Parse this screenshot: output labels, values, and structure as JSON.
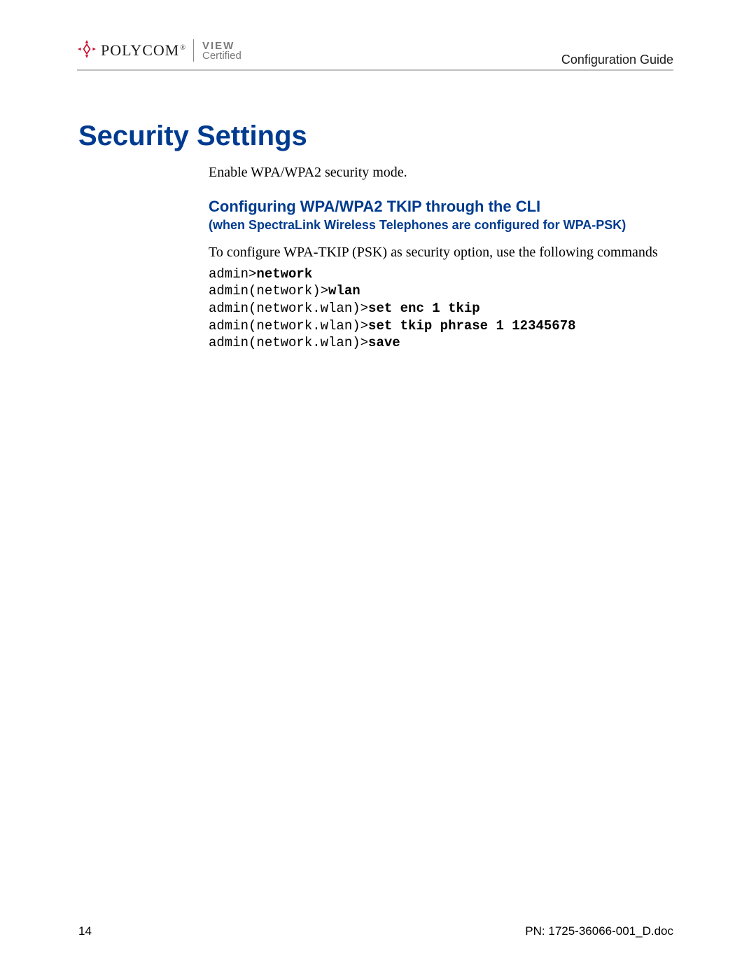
{
  "header": {
    "brand_name": "POLYCOM",
    "brand_mark_sup": "®",
    "view_line1": "VIEW",
    "view_line2": "Certified",
    "right_text": "Configuration Guide"
  },
  "title": "Security Settings",
  "intro": "Enable WPA/WPA2 security mode.",
  "subheading": "Configuring WPA/WPA2 TKIP through the CLI",
  "subnote": "(when SpectraLink Wireless Telephones are configured for WPA-PSK)",
  "para": "To configure WPA-TKIP (PSK) as security option, use the following commands",
  "cmds": [
    {
      "prompt": "admin>",
      "bold": "network"
    },
    {
      "prompt": "admin(network)>",
      "bold": "wlan"
    },
    {
      "prompt": "admin(network.wlan)>",
      "bold": "set enc 1 tkip"
    },
    {
      "prompt": "admin(network.wlan)>",
      "bold": "set tkip phrase 1 12345678"
    },
    {
      "prompt": "admin(network.wlan)>",
      "bold": "save"
    }
  ],
  "footer": {
    "page_number": "14",
    "pn_label": "PN: 1725-36066-001_D.doc"
  }
}
